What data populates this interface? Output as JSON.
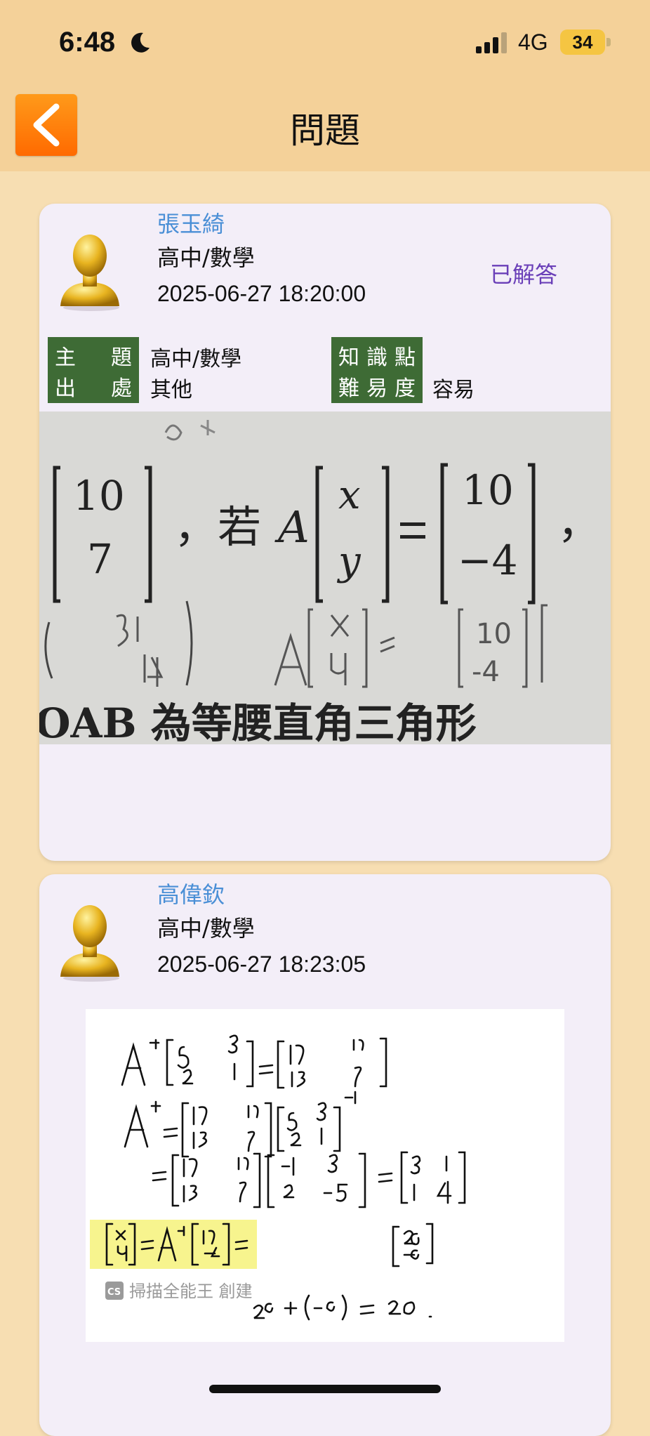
{
  "status_bar": {
    "time": "6:48",
    "network": "4G",
    "battery": "34"
  },
  "nav": {
    "title": "問題"
  },
  "posts": [
    {
      "name": "張玉綺",
      "subject": "高中/數學",
      "datetime": "2025-06-27 18:20:00",
      "status": "已解答",
      "meta": {
        "topic_label": "主　題",
        "topic_value": "高中/數學",
        "source_label": "出　處",
        "source_value": "其他",
        "knowledge_label": "知識點",
        "difficulty_label": "難易度",
        "difficulty_value": "容易"
      },
      "image_text": {
        "cond": "，若",
        "a": "A",
        "bottom": "OAB 為等腰直角三角形"
      }
    },
    {
      "name": "高偉欽",
      "subject": "高中/數學",
      "datetime": "2025-06-27 18:23:05",
      "watermark": "掃描全能王 創建"
    }
  ],
  "colors": {
    "background": "#f7deb2",
    "header": "#f4d199",
    "card": "#f3eef8",
    "name": "#4a8fd6",
    "status": "#6a3fb8",
    "tag": "#3e6b35",
    "back_button": "#ff7a00"
  },
  "icons": [
    "moon-icon",
    "signal-icon",
    "back-arrow-icon",
    "avatar-icon"
  ]
}
